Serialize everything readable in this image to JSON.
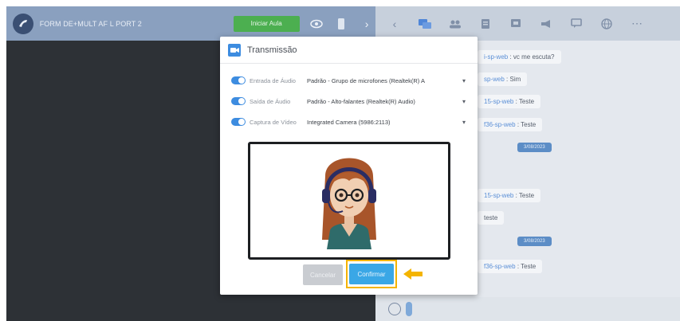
{
  "window": {
    "room_title": "FORM DE+MULT AF L PORT 2",
    "green_button_label": "Iniciar Aula"
  },
  "topbar_left_icons": [
    "eye-icon",
    "phone-icon",
    "chevron-right-icon"
  ],
  "topbar_right_icons": [
    "chevron-left-icon",
    "chat-icon",
    "users-icon",
    "document-icon",
    "screen-share-icon",
    "megaphone-icon",
    "comment-icon",
    "globe-icon",
    "more-icon"
  ],
  "chat": {
    "messages": [
      {
        "sender": "i-sp-web",
        "text": ": vc me escuta?"
      },
      {
        "sender": "sp-web",
        "text": ": Sim"
      },
      {
        "sender": "15-sp-web",
        "text": ": Teste"
      },
      {
        "sender": "f36-sp-web",
        "text": ": Teste"
      },
      {
        "sender": "15-sp-web",
        "text": ": Teste"
      },
      {
        "sender": "",
        "text": "teste"
      },
      {
        "sender": "f36-sp-web",
        "text": ": Teste"
      }
    ],
    "date_chips": [
      "3/08/2023",
      "3/08/2023"
    ]
  },
  "modal": {
    "title": "Transmissão",
    "rows": [
      {
        "label": "Entrada de Áudio",
        "value": "Padrão - Grupo de microfones (Realtek(R) A"
      },
      {
        "label": "Saída de Áudio",
        "value": "Padrão - Alto-falantes (Realtek(R) Audio)"
      },
      {
        "label": "Captura de Vídeo",
        "value": "Integrated Camera (5986:2113)"
      }
    ],
    "cancel_label": "Cancelar",
    "confirm_label": "Confirmar"
  },
  "colors": {
    "accent": "#3d8ce0",
    "confirm": "#3aa7e6",
    "highlight": "#f4b400",
    "topbar": "#8aa0bf",
    "green": "#4caf50"
  }
}
